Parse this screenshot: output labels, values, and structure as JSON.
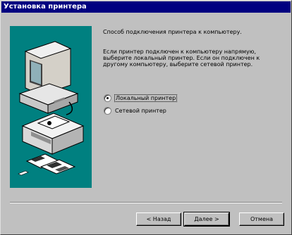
{
  "window": {
    "title": "Установка принтера"
  },
  "colors": {
    "titlebar": "#000080",
    "face": "#c0c0c0",
    "art_bg": "#008080"
  },
  "content": {
    "heading": "Способ подключения принтера к компьютеру.",
    "description_lines": [
      "Если принтер подключен к компьютеру напрямую,",
      "выберите локальный принтер. Если он подключен к",
      "другому компьютеру, выберите сетевой принтер."
    ],
    "options": [
      {
        "label": "Локальный принтер",
        "selected": true
      },
      {
        "label": "Сетевой принтер",
        "selected": false
      }
    ]
  },
  "buttons": {
    "back": "< Назад",
    "next": "Далее >",
    "cancel": "Отмена"
  },
  "icons": [
    "computer-icon",
    "printer-icon",
    "printed-pages-icon"
  ]
}
